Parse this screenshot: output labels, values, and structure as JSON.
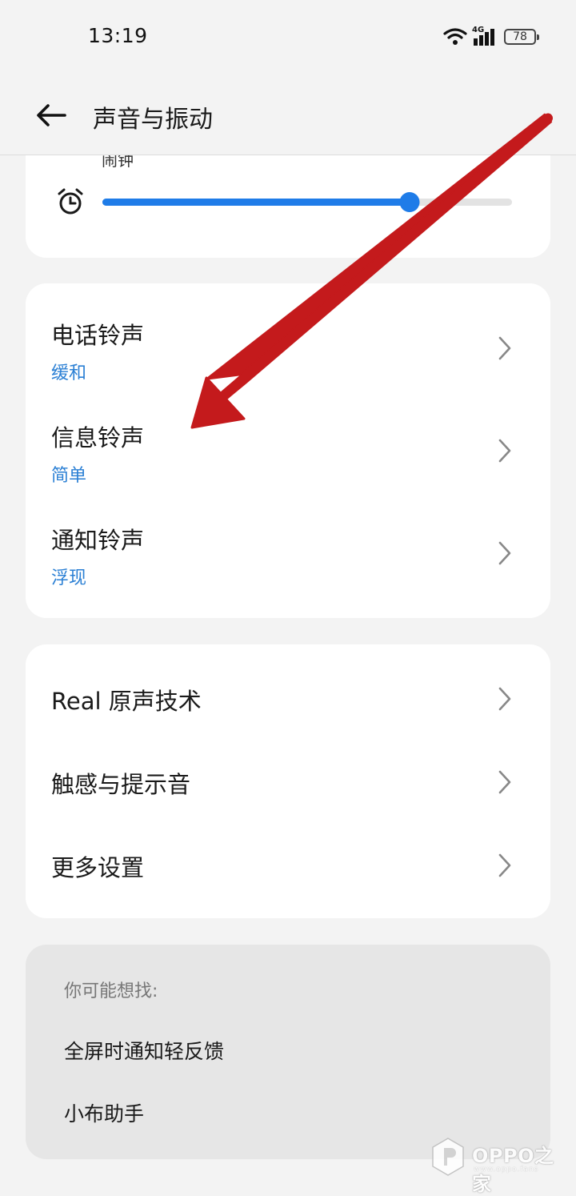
{
  "status_bar": {
    "time": "13:19",
    "network": "4G",
    "battery": "78"
  },
  "app_bar": {
    "title": "声音与振动"
  },
  "volume": {
    "label": "闹钟",
    "level_percent": 75
  },
  "ringtones": [
    {
      "title": "电话铃声",
      "value": "缓和"
    },
    {
      "title": "信息铃声",
      "value": "简单"
    },
    {
      "title": "通知铃声",
      "value": "浮现"
    }
  ],
  "more_settings": [
    {
      "title": "Real 原声技术"
    },
    {
      "title": "触感与提示音"
    },
    {
      "title": "更多设置"
    }
  ],
  "suggestions": {
    "heading": "你可能想找:",
    "items": [
      "全屏时通知轻反馈",
      "小布助手"
    ]
  },
  "watermark": {
    "text": "OPPO之家",
    "sub": "www.oppo.fans",
    "color": "#ffffff"
  },
  "annotation": {
    "arrow_color": "#c41a1c"
  },
  "colors": {
    "accent": "#1f7ce8",
    "subtitle": "#2a7fd4",
    "background": "#f3f3f3"
  }
}
